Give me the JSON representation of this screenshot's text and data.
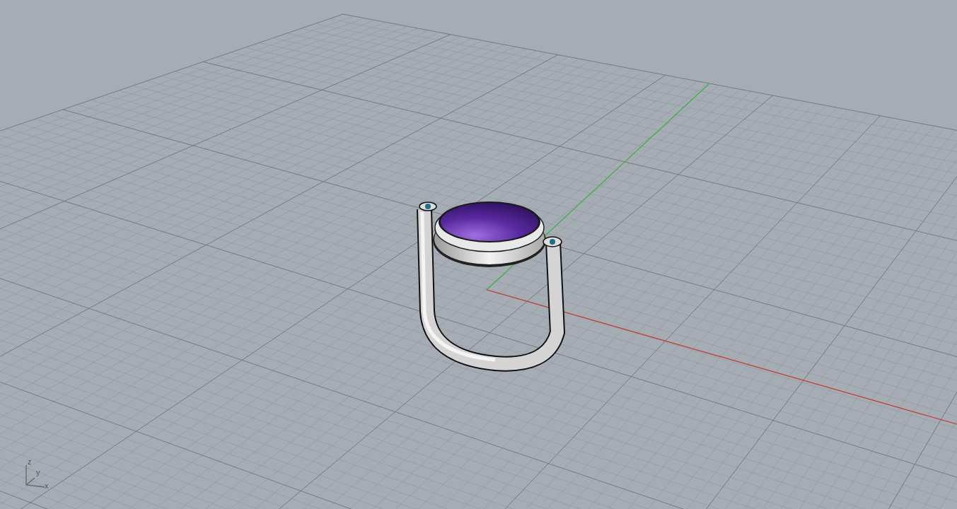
{
  "viewport": {
    "axis_gizmo": {
      "labels": [
        "z",
        "y",
        "x"
      ]
    }
  }
}
